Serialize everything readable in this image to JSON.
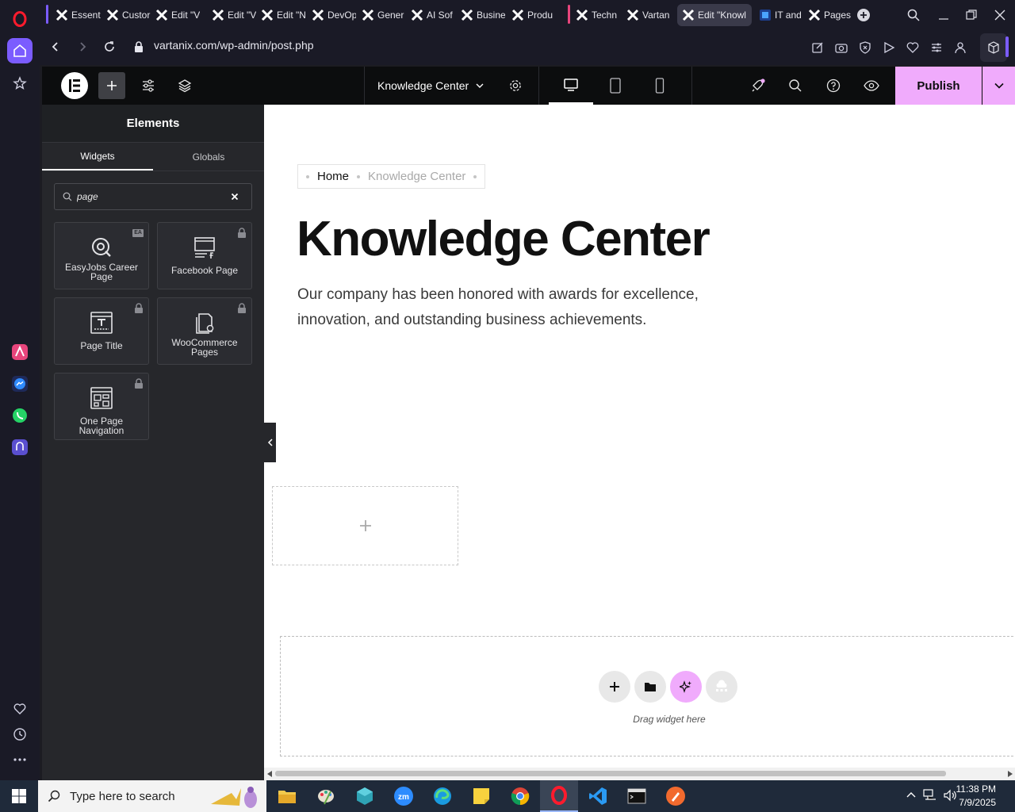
{
  "browser": {
    "tabs": [
      {
        "label": "Essent",
        "favicon": "elementor-x-icon"
      },
      {
        "label": "Custor",
        "favicon": "elementor-x-icon"
      },
      {
        "label": "Edit \"V",
        "favicon": "elementor-x-icon"
      },
      {
        "label": "Edit \"V",
        "favicon": "elementor-x-icon"
      },
      {
        "label": "Edit \"N",
        "favicon": "elementor-x-icon"
      },
      {
        "label": "DevOp",
        "favicon": "elementor-x-icon"
      },
      {
        "label": "Gener",
        "favicon": "elementor-x-icon"
      },
      {
        "label": "AI Sof",
        "favicon": "elementor-x-icon"
      },
      {
        "label": "Busine",
        "favicon": "elementor-x-icon"
      },
      {
        "label": "Produ",
        "favicon": "elementor-x-icon"
      },
      {
        "label": "Techn",
        "favicon": "elementor-x-icon"
      },
      {
        "label": "Vartan",
        "favicon": "elementor-x-icon"
      },
      {
        "label": "Edit \"Knowl",
        "favicon": "elementor-x-icon"
      },
      {
        "label": "IT and",
        "favicon": "blue-site-icon"
      },
      {
        "label": "Pages",
        "favicon": "elementor-x-icon"
      }
    ],
    "url": "vartanix.com/wp-admin/post.php",
    "accent": "#7b5cff"
  },
  "elementor": {
    "page_name": "Knowledge Center",
    "publish_label": "Publish",
    "publish_color": "#f0abfc"
  },
  "panel": {
    "title": "Elements",
    "tabs": [
      "Widgets",
      "Globals"
    ],
    "search_value": "page",
    "widgets": [
      {
        "label": "EasyJobs Career Page",
        "icon": "easyjobs-icon",
        "badge": "EA",
        "locked": false
      },
      {
        "label": "Facebook Page",
        "icon": "facebook-page-icon",
        "locked": true
      },
      {
        "label": "Page Title",
        "icon": "page-title-icon",
        "locked": true
      },
      {
        "label": "WooCommerce Pages",
        "icon": "woocommerce-pages-icon",
        "locked": true
      },
      {
        "label": "One Page Navigation",
        "icon": "one-page-navigation-icon",
        "locked": true
      }
    ]
  },
  "canvas": {
    "breadcrumb": [
      "Home",
      "Knowledge Center"
    ],
    "title": "Knowledge Center",
    "description": "Our company has been honored with awards for excellence, innovation, and outstanding business achievements.",
    "dropzone_text": "Drag widget here"
  },
  "taskbar": {
    "search_placeholder": "Type here to search",
    "time": "11:38 PM",
    "date": "7/9/2025"
  }
}
